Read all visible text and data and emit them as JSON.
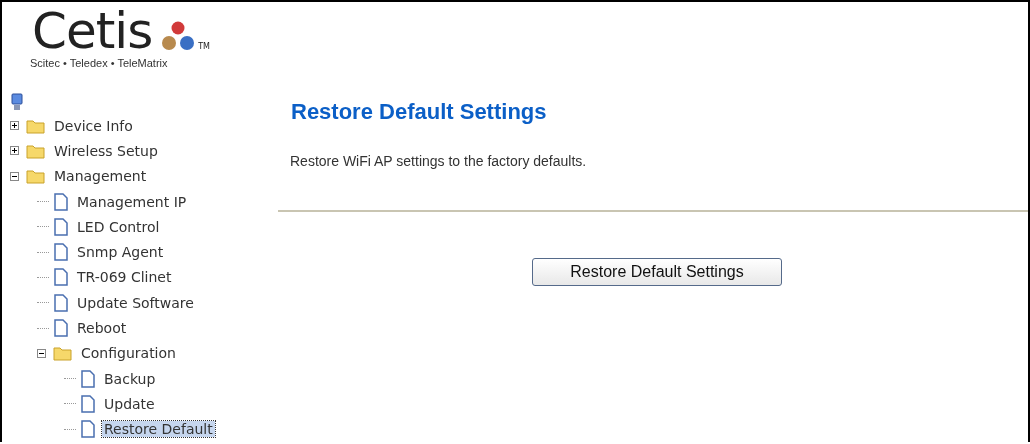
{
  "logo": {
    "brand": "Cetis",
    "tm": "TM",
    "tagline": "Scitec • Teledex • TeleMatrix"
  },
  "tree": [
    {
      "label": "Device Info",
      "kind": "folder",
      "expanded": false,
      "selected": false
    },
    {
      "label": "Wireless Setup",
      "kind": "folder",
      "expanded": false,
      "selected": false
    },
    {
      "label": "Management",
      "kind": "folder",
      "expanded": true,
      "selected": false,
      "children": [
        {
          "label": "Management IP",
          "kind": "page",
          "selected": false
        },
        {
          "label": "LED Control",
          "kind": "page",
          "selected": false
        },
        {
          "label": "Snmp Agent",
          "kind": "page",
          "selected": false
        },
        {
          "label": "TR-069 Clinet",
          "kind": "page",
          "selected": false
        },
        {
          "label": "Update Software",
          "kind": "page",
          "selected": false
        },
        {
          "label": "Reboot",
          "kind": "page",
          "selected": false
        },
        {
          "label": "Configuration",
          "kind": "folder",
          "expanded": true,
          "selected": false,
          "children": [
            {
              "label": "Backup",
              "kind": "page",
              "selected": false
            },
            {
              "label": "Update",
              "kind": "page",
              "selected": false
            },
            {
              "label": "Restore Default",
              "kind": "page",
              "selected": true
            }
          ]
        }
      ]
    }
  ],
  "main": {
    "title": "Restore Default Settings",
    "description": "Restore WiFi AP settings to the factory defaults.",
    "button": "Restore Default Settings"
  }
}
